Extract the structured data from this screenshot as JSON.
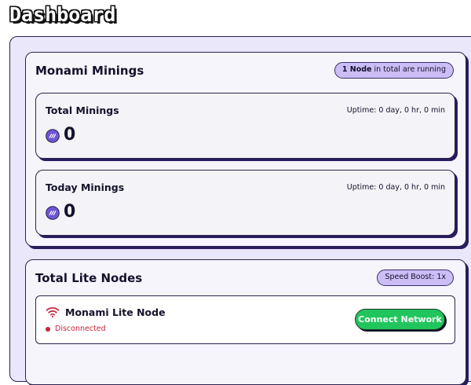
{
  "header": {
    "title": "Dashboard"
  },
  "mining": {
    "title": "Monami Minings",
    "badge": {
      "count": "1 Node",
      "suffix": " in total are running"
    },
    "total": {
      "label": "Total Minings",
      "uptime": "Uptime: 0 day, 0 hr, 0 min",
      "value": "0"
    },
    "today": {
      "label": "Today Minings",
      "uptime": "Uptime: 0 day, 0 hr, 0 min",
      "value": "0"
    },
    "icon": "monami-coin-icon"
  },
  "nodes": {
    "title": "Total Lite Nodes",
    "badge": "Speed Boost: 1x",
    "items": [
      {
        "name": "Monami Lite Node",
        "status": "Disconnected",
        "status_color": "#c8243a",
        "icon": "wifi-icon",
        "action_label": "Connect Network"
      }
    ]
  },
  "colors": {
    "panel_bg": "#ebe7fb",
    "badge_bg": "#cbbdf5",
    "accent_purple": "#6e55d4",
    "button_green": "#21c55d"
  }
}
